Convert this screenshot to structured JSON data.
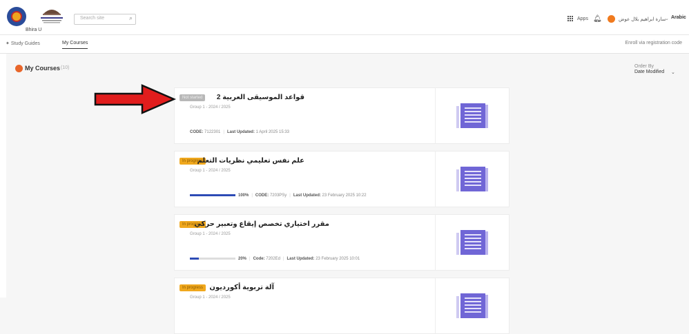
{
  "header": {
    "brand_under": "Bhira U",
    "search_placeholder": "Search site",
    "apps_label": "Apps",
    "user_name": "سارة ابراهيم بلال عوض",
    "lang": "Arabic"
  },
  "subnav": {
    "items": [
      "Study Guides",
      "My Courses"
    ],
    "active": "My Courses",
    "right": "Enroll via registration code"
  },
  "page": {
    "title": "My Courses",
    "count": "(10)",
    "order_label": "Order By",
    "order_value": "Date Modified"
  },
  "colors": {
    "accent": "#2d4bb5",
    "badge_amber": "#f0a81e",
    "badge_grey": "#b8b8b8",
    "arrow": "#e11d1d",
    "thumb": "#7066d6"
  },
  "courses": [
    {
      "title": "قواعد الموسيقى العربية 2",
      "badge": "Not started",
      "badge_style": "grey",
      "group": "Group 1 - 2024 / 2025",
      "progress": null,
      "progress_label": "",
      "code_label": "CODE:",
      "code": "7122301",
      "updated_label": "Last Updated:",
      "updated": "1 April 2025 15:33"
    },
    {
      "title": "علم نفس تعليمي نظريات التعلم",
      "badge": "In progress",
      "badge_style": "amber",
      "group": "Group 1 - 2024 / 2025",
      "progress": 1.0,
      "progress_label": "100%",
      "code_label": "CODE:",
      "code": "7203PSy",
      "updated_label": "Last Updated:",
      "updated": "23 February 2025 10:22"
    },
    {
      "title": "مقرر اختياري تخصص إيقاع وتعبير حركي",
      "badge": "In progress",
      "badge_style": "amber",
      "group": "Group 1 - 2024 / 2025",
      "progress": 0.2,
      "progress_label": "20%",
      "code_label": "Code:",
      "code": "7202Ed",
      "updated_label": "Last Updated:",
      "updated": "23 February 2025 10:01"
    },
    {
      "title": "آلة تربوية أكورديون",
      "badge": "In progress",
      "badge_style": "amber",
      "group": "Group 1 - 2024 / 2025",
      "progress": null,
      "progress_label": "",
      "code_label": "",
      "code": "",
      "updated_label": "",
      "updated": ""
    }
  ]
}
